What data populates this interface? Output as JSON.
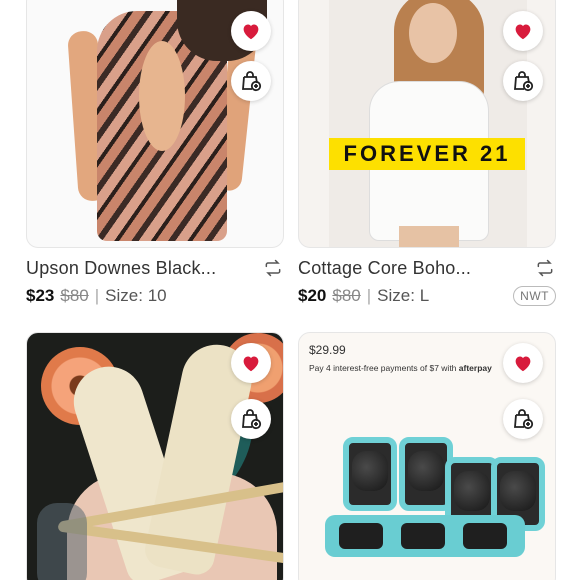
{
  "colors": {
    "heart": "#d81b3c",
    "text": "#222222",
    "muted": "#888888",
    "nwt_border": "#bbbbbb"
  },
  "listings": [
    {
      "title": "Upson Downes Black...",
      "price": "$23",
      "original_price": "$80",
      "size_label": "Size: 10",
      "separator": "|",
      "icons": [
        "heart-icon",
        "bag-plus-icon",
        "repost-icon"
      ]
    },
    {
      "title": "Cottage Core Boho...",
      "price": "$20",
      "original_price": "$80",
      "size_label": "Size: L",
      "separator": "|",
      "badge": "NWT",
      "brand_banner": "FOREVER 21",
      "icons": [
        "heart-icon",
        "bag-plus-icon",
        "repost-icon"
      ]
    },
    {
      "icons": [
        "heart-icon",
        "bag-plus-icon"
      ]
    },
    {
      "image_price": "$29.99",
      "afterpay_text": "Pay 4 interest-free payments of $7 with",
      "afterpay_brand": "afterpay",
      "icons": [
        "heart-icon",
        "bag-plus-icon"
      ]
    }
  ]
}
